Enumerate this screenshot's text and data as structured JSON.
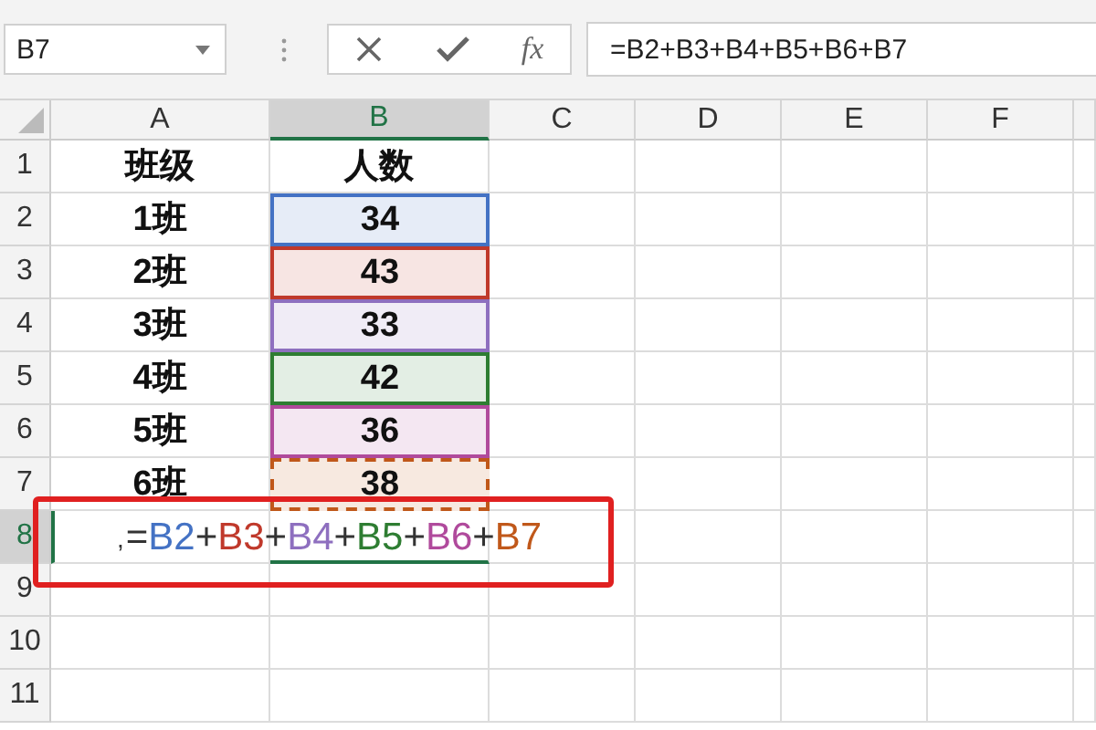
{
  "name_box": {
    "value": "B7"
  },
  "formula_bar": {
    "fx": "fx",
    "value": "=B2+B3+B4+B5+B6+B7"
  },
  "columns": [
    {
      "label": "A",
      "selected": false
    },
    {
      "label": "B",
      "selected": true
    },
    {
      "label": "C",
      "selected": false
    },
    {
      "label": "D",
      "selected": false
    },
    {
      "label": "E",
      "selected": false
    },
    {
      "label": "F",
      "selected": false
    }
  ],
  "rows": [
    {
      "number": "1",
      "selected": false,
      "a": "班级",
      "b": "人数"
    },
    {
      "number": "2",
      "selected": false,
      "a": "1班",
      "b": "34",
      "color": "#4472c4"
    },
    {
      "number": "3",
      "selected": false,
      "a": "2班",
      "b": "43",
      "color": "#c0392b"
    },
    {
      "number": "4",
      "selected": false,
      "a": "3班",
      "b": "33",
      "color": "#8e6fbf"
    },
    {
      "number": "5",
      "selected": false,
      "a": "4班",
      "b": "42",
      "color": "#2e7d32"
    },
    {
      "number": "6",
      "selected": false,
      "a": "5班",
      "b": "36",
      "color": "#b04a9c"
    },
    {
      "number": "7",
      "selected": false,
      "a": "6班",
      "b": "38",
      "color": "#c0581a",
      "copied": true
    },
    {
      "number": "8",
      "selected": true,
      "editing": true
    },
    {
      "number": "9",
      "selected": false
    },
    {
      "number": "10",
      "selected": false
    },
    {
      "number": "11",
      "selected": false
    }
  ],
  "formula_edit": {
    "cursor": ",",
    "parts": [
      {
        "text": "=",
        "color": "#333333"
      },
      {
        "text": "B2",
        "color": "#4472c4"
      },
      {
        "text": "+",
        "color": "#333333"
      },
      {
        "text": "B3",
        "color": "#c0392b"
      },
      {
        "text": "+",
        "color": "#333333"
      },
      {
        "text": "B4",
        "color": "#8e6fbf"
      },
      {
        "text": "+",
        "color": "#333333"
      },
      {
        "text": "B5",
        "color": "#2e7d32"
      },
      {
        "text": "+",
        "color": "#333333"
      },
      {
        "text": "B6",
        "color": "#b04a9c"
      },
      {
        "text": "+",
        "color": "#333333"
      },
      {
        "text": "B7",
        "color": "#c0581a"
      }
    ]
  }
}
